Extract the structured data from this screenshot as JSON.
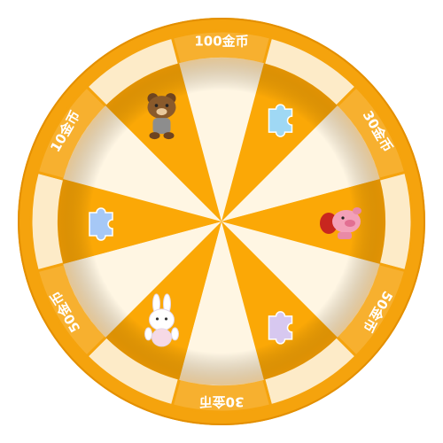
{
  "wheel": {
    "colors": {
      "rim": "#f5a30d",
      "rim_dark": "#e38f00",
      "outer_sector_orange": "#f7b02f",
      "outer_sector_cream": "#fdebc8",
      "inner_orange": "#fba806",
      "inner_cream": "#fff6e3",
      "label_text": "#ffffff"
    },
    "outer_labels": [
      {
        "text": "100金币"
      },
      {
        "text": "30金币"
      },
      {
        "text": "50金币"
      },
      {
        "text": "30金币"
      },
      {
        "text": "50金币"
      },
      {
        "text": "10金币"
      }
    ],
    "inner_prizes": [
      {
        "icon": "puzzle-icon",
        "color": "#9fd8f4"
      },
      {
        "icon": "pig-plush-icon",
        "color": "#f3a0b8"
      },
      {
        "icon": "puzzle-icon",
        "color": "#d7c8f0"
      },
      {
        "icon": "bunny-plush-icon",
        "color": "#ffffff"
      },
      {
        "icon": "puzzle-icon",
        "color": "#a6c8f6"
      },
      {
        "icon": "bear-plush-icon",
        "color": "#8a5a2b"
      }
    ]
  }
}
